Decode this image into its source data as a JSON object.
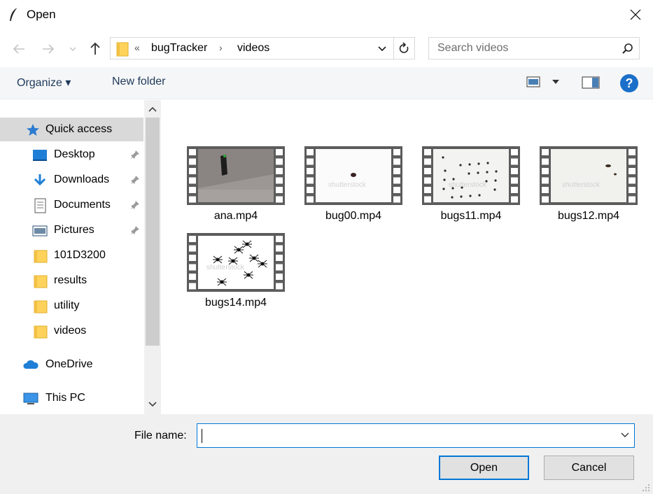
{
  "window": {
    "title": "Open",
    "icon": "feather-icon",
    "close_icon": "close-icon"
  },
  "nav": {
    "back_icon": "arrow-left-icon",
    "forward_icon": "arrow-right-icon",
    "recent_icon": "chevron-down-icon",
    "up_icon": "arrow-up-icon"
  },
  "address": {
    "overflow": "«",
    "crumbs": [
      "bugTracker",
      "videos"
    ],
    "separator": "›",
    "refresh_icon": "refresh-icon"
  },
  "search": {
    "placeholder": "Search videos",
    "icon": "search-icon"
  },
  "toolbar": {
    "organize_label": "Organize ▾",
    "new_folder_label": "New folder",
    "help_label": "?"
  },
  "sidebar": {
    "items": [
      {
        "label": "Quick access",
        "icon": "star-icon",
        "pinned": false,
        "selected": true
      },
      {
        "label": "Desktop",
        "icon": "desktop-icon",
        "pinned": true
      },
      {
        "label": "Downloads",
        "icon": "download-icon",
        "pinned": true
      },
      {
        "label": "Documents",
        "icon": "document-icon",
        "pinned": true
      },
      {
        "label": "Pictures",
        "icon": "pictures-icon",
        "pinned": true
      },
      {
        "label": "101D3200",
        "icon": "folder-icon",
        "pinned": false
      },
      {
        "label": "results",
        "icon": "folder-icon",
        "pinned": false
      },
      {
        "label": "utility",
        "icon": "folder-icon",
        "pinned": false
      },
      {
        "label": "videos",
        "icon": "folder-icon",
        "pinned": false
      },
      {
        "label": "OneDrive",
        "icon": "cloud-icon",
        "pinned": false
      },
      {
        "label": "This PC",
        "icon": "computer-icon",
        "pinned": false
      }
    ]
  },
  "files": [
    {
      "name": "ana.mp4",
      "thumb": "video-thumbnail"
    },
    {
      "name": "bug00.mp4",
      "thumb": "video-thumbnail"
    },
    {
      "name": "bugs11.mp4",
      "thumb": "video-thumbnail"
    },
    {
      "name": "bugs12.mp4",
      "thumb": "video-thumbnail"
    },
    {
      "name": "bugs14.mp4",
      "thumb": "video-thumbnail"
    }
  ],
  "footer": {
    "file_name_label": "File name:",
    "file_name_value": "",
    "open_label": "Open",
    "cancel_label": "Cancel"
  },
  "colors": {
    "accent": "#0078d7",
    "help": "#1a6fc9",
    "folder": "#ffd35b"
  }
}
